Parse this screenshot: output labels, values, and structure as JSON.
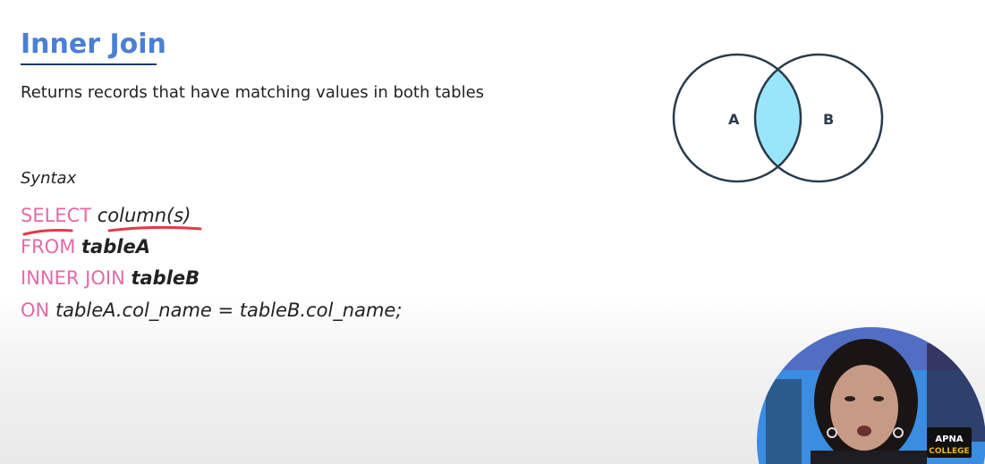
{
  "slide": {
    "title": "Inner Join",
    "subtitle": "Returns records that have matching values in both tables",
    "syntax_label": "Syntax"
  },
  "code": {
    "line1": {
      "keyword": "SELECT",
      "arg": "column(s)"
    },
    "line2": {
      "keyword": "FROM",
      "arg": "tableA"
    },
    "line3": {
      "keyword": "INNER JOIN",
      "arg": "tableB"
    },
    "line4": {
      "keyword": "ON",
      "arg": "tableA.col_name = tableB.col_name;"
    }
  },
  "venn": {
    "left_label": "A",
    "right_label": "B",
    "intersection_color": "#99e6fb"
  },
  "presenter": {
    "logo_line1": "APNA",
    "logo_line2": "COLLEGE",
    "background_color": "#3a8de0",
    "logo_accent": "#f0b323"
  }
}
